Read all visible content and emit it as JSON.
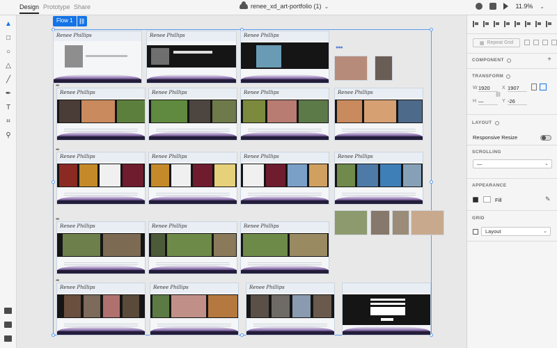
{
  "topbar": {
    "tabs": [
      {
        "label": "Design",
        "active": true
      },
      {
        "label": "Prototype",
        "active": false
      },
      {
        "label": "Share",
        "active": false
      }
    ],
    "document_title": "renee_xd_art-portfolio (1)",
    "zoom": "11.9%"
  },
  "canvas": {
    "flow_label": "Flow 1",
    "artboard_logo": "Renee Phillips"
  },
  "panel": {
    "repeat_grid_label": "Repeat Grid",
    "component_label": "COMPONENT",
    "transform_label": "TRANSFORM",
    "w_label": "W",
    "w_value": "1920",
    "x_label": "X",
    "x_value": "1907",
    "h_label": "H",
    "h_value": "—",
    "y_label": "Y",
    "y_value": "-26",
    "layout_label": "LAYOUT",
    "responsive_resize_label": "Responsive Resize",
    "responsive_resize_on": false,
    "scrolling_label": "SCROLLING",
    "scrolling_value": "—",
    "appearance_label": "APPEARANCE",
    "fill_label": "Fill",
    "fill_checked": true,
    "grid_label": "GRID",
    "grid_value": "Layout",
    "grid_checked": false
  },
  "colors": {
    "accent": "#1473e6",
    "artboard_footer": "#241d3a",
    "wave_purple": "#9a7fb8"
  }
}
